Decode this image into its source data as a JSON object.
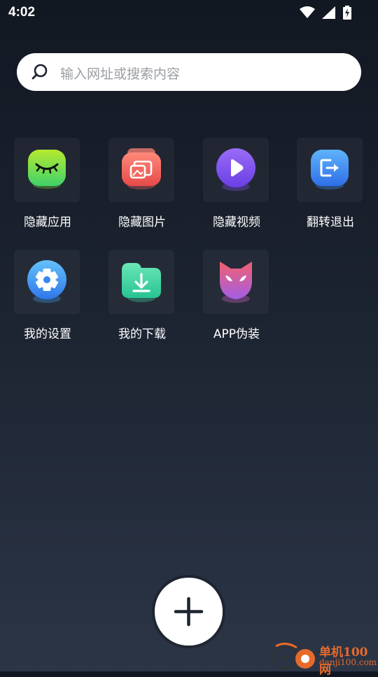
{
  "status_bar": {
    "time": "4:02",
    "icons": [
      "wifi-icon",
      "signal-icon",
      "battery-charging-icon"
    ]
  },
  "search": {
    "placeholder": "输入网址或搜索内容",
    "icon": "search-icon"
  },
  "grid": {
    "items": [
      {
        "label": "隐藏应用",
        "icon": "eye-closed-icon",
        "color": "#7ed321"
      },
      {
        "label": "隐藏图片",
        "icon": "image-icon",
        "color": "#f0605a"
      },
      {
        "label": "隐藏视频",
        "icon": "play-icon",
        "color": "#7b4df0"
      },
      {
        "label": "翻转退出",
        "icon": "exit-icon",
        "color": "#3b8ef5"
      },
      {
        "label": "我的设置",
        "icon": "gear-icon",
        "color": "#3a9cf2"
      },
      {
        "label": "我的下载",
        "icon": "download-icon",
        "color": "#3fd7a1"
      },
      {
        "label": "APP伪装",
        "icon": "mask-icon",
        "color": "#d55fcb"
      }
    ]
  },
  "fab": {
    "icon": "plus-icon"
  },
  "watermark": {
    "name": "单机100网",
    "url": "danji100.com"
  }
}
